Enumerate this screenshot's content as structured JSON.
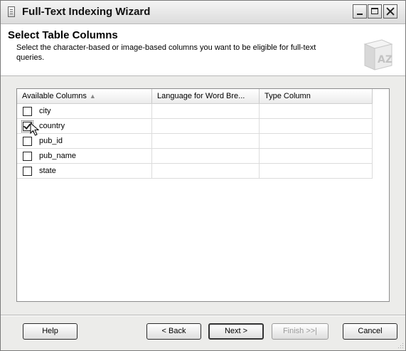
{
  "window": {
    "title": "Full-Text Indexing Wizard"
  },
  "header": {
    "title": "Select Table Columns",
    "description": "Select the character-based or image-based columns you want to be eligible for full-text queries."
  },
  "grid": {
    "columns": [
      "Available Columns",
      "Language for Word Bre...",
      "Type Column"
    ],
    "sorted_column": "Available Columns",
    "rows": [
      {
        "name": "city",
        "checked": false
      },
      {
        "name": "country",
        "checked": true
      },
      {
        "name": "pub_id",
        "checked": false
      },
      {
        "name": "pub_name",
        "checked": false
      },
      {
        "name": "state",
        "checked": false
      }
    ]
  },
  "buttons": {
    "help": "Help",
    "back": "< Back",
    "next": "Next >",
    "finish": "Finish >>|",
    "cancel": "Cancel"
  },
  "icons": {
    "title": "wizard-icon",
    "header": "az-book-icon",
    "cursor": "mouse-pointer-icon",
    "grip": "resize-grip-icon"
  }
}
